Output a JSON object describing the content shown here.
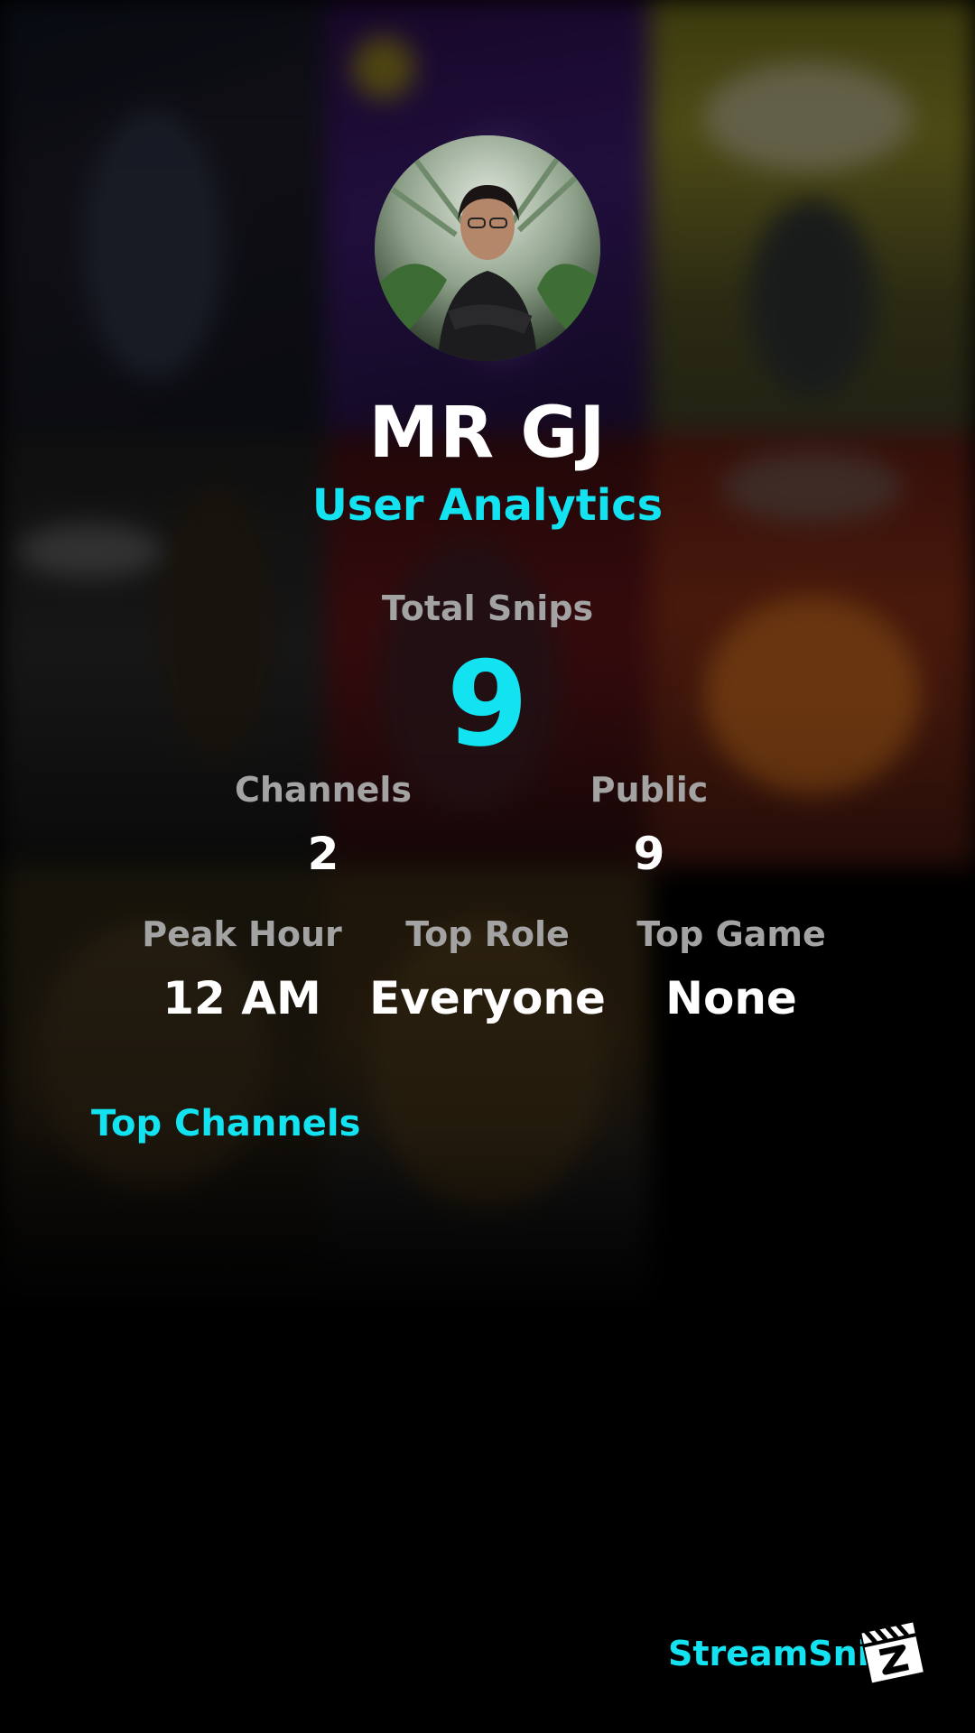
{
  "profile": {
    "display_name": "MR GJ",
    "subtitle": "User Analytics"
  },
  "stats": {
    "total_snips_label": "Total Snips",
    "total_snips_value": "9",
    "channels_label": "Channels",
    "channels_value": "2",
    "public_label": "Public",
    "public_value": "9",
    "peak_hour_label": "Peak Hour",
    "peak_hour_value": "12 AM",
    "top_role_label": "Top Role",
    "top_role_value": "Everyone",
    "top_game_label": "Top Game",
    "top_game_value": "None"
  },
  "sections": {
    "top_channels_heading": "Top Channels"
  },
  "footer": {
    "brand_name": "StreamSnip",
    "logo_icon": "clapperboard-icon"
  },
  "colors": {
    "accent": "#13e2f0",
    "label_gray": "#a3a3a3",
    "text_white": "#ffffff",
    "background": "#000000"
  }
}
